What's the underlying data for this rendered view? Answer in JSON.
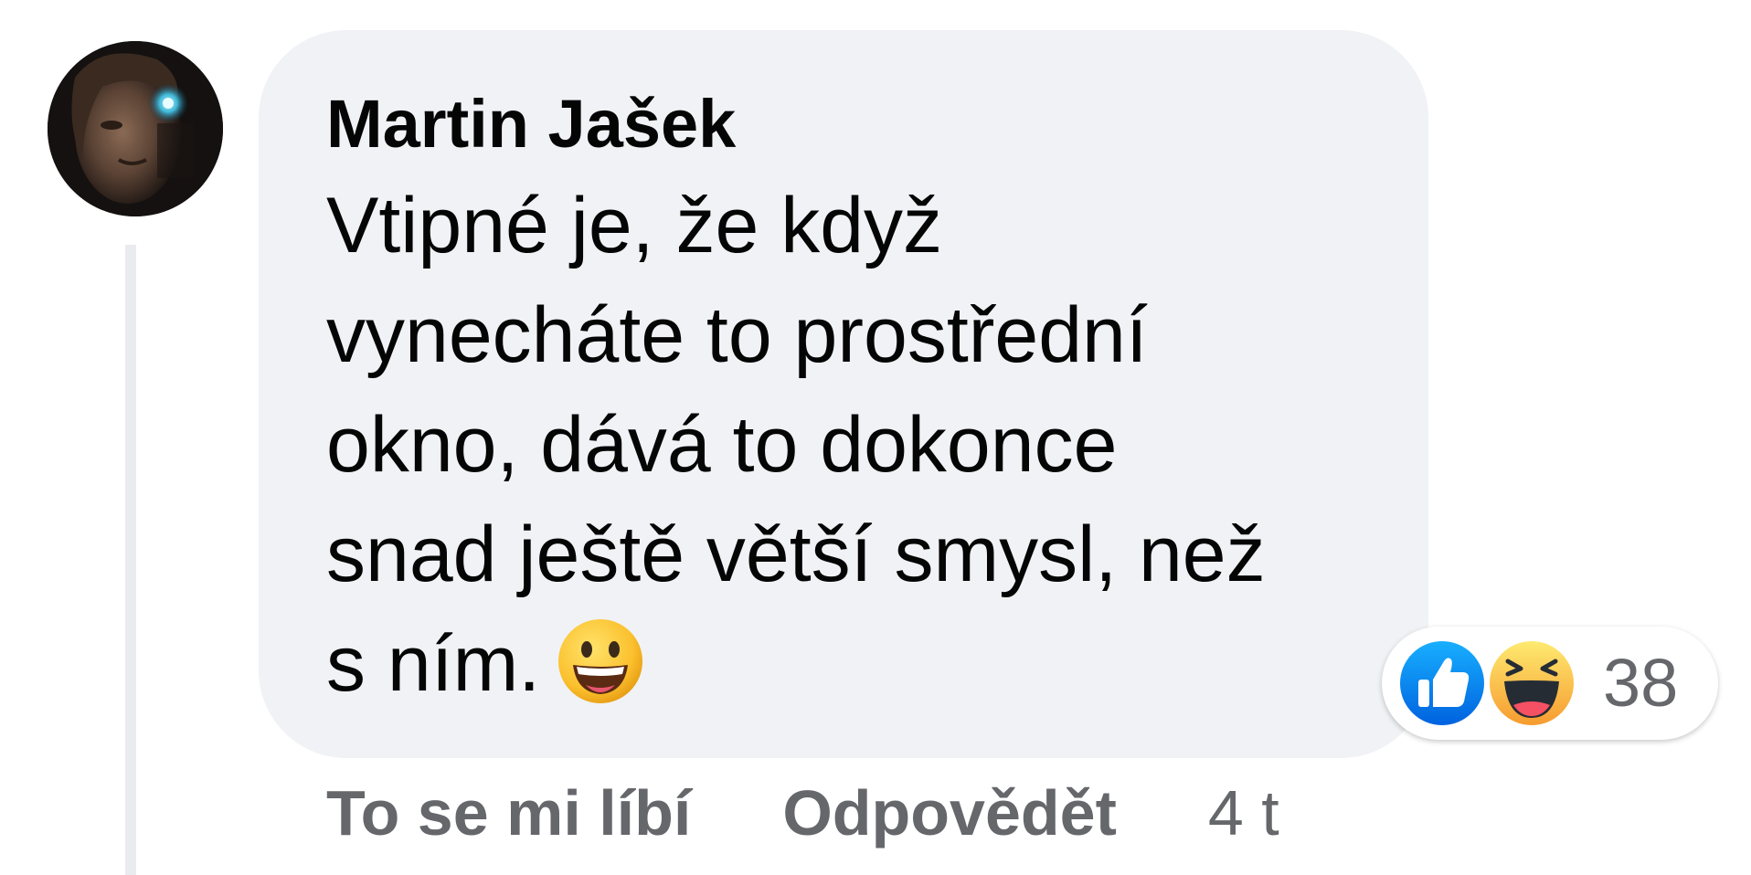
{
  "comment": {
    "author": "Martin Jašek",
    "text_lines": [
      "Vtipné je, že když",
      "vynecháte to prostřední",
      "okno, dává to dokonce",
      "snad ještě větší smysl, než",
      "s ním."
    ],
    "trailing_emoji": "grinning-face-emoji"
  },
  "reactions": {
    "types": [
      "like",
      "haha"
    ],
    "count": "38",
    "like_color": "#1877f2",
    "haha_color": "#f7b928"
  },
  "actions": {
    "like_label": "To se mi líbí",
    "reply_label": "Odpovědět",
    "timestamp": "4 t"
  },
  "colors": {
    "bubble_background": "#f0f2f5",
    "secondary_text": "#65676b",
    "primary_text": "#050505"
  }
}
